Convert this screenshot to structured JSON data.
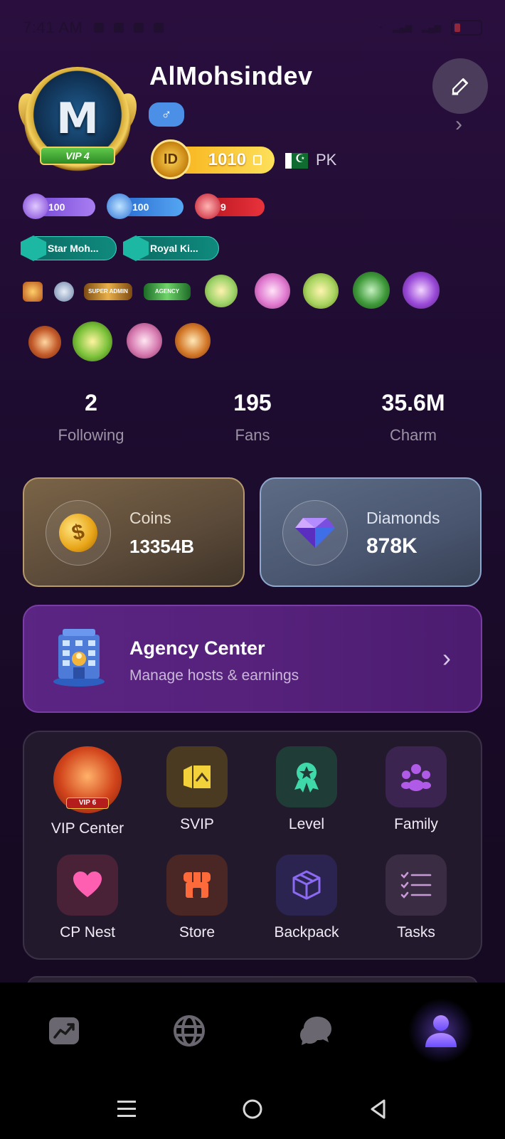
{
  "status_bar": {
    "time": "7:41 AM"
  },
  "profile": {
    "avatar_vip_label": "VIP 4",
    "avatar_letter": "M",
    "username": "AlMohsindev",
    "gender_symbol": "♂",
    "id_badge_label": "ID",
    "id_value": "1010",
    "country_code": "PK"
  },
  "level_badges": [
    {
      "value": "100",
      "color": "purple"
    },
    {
      "value": "100",
      "color": "blue"
    },
    {
      "value": "9",
      "color": "red"
    }
  ],
  "title_badges": [
    "Star Moh...",
    "Royal Ki..."
  ],
  "medal_labels": [
    "SUPER ADMIN",
    "AGENCY"
  ],
  "stats": {
    "following": {
      "value": "2",
      "label": "Following"
    },
    "fans": {
      "value": "195",
      "label": "Fans"
    },
    "charm": {
      "value": "35.6M",
      "label": "Charm"
    }
  },
  "wallet": {
    "coins": {
      "label": "Coins",
      "value": "13354B"
    },
    "diamonds": {
      "label": "Diamonds",
      "value": "878K"
    }
  },
  "agency": {
    "title": "Agency Center",
    "subtitle": "Manage hosts & earnings"
  },
  "menu": {
    "vip_badge_label": "VIP 6",
    "items": [
      {
        "label": "VIP Center",
        "icon": "vip-crest-icon"
      },
      {
        "label": "SVIP",
        "icon": "svip-icon"
      },
      {
        "label": "Level",
        "icon": "level-award-icon"
      },
      {
        "label": "Family",
        "icon": "family-icon"
      },
      {
        "label": "CP Nest",
        "icon": "heart-icon"
      },
      {
        "label": "Store",
        "icon": "store-icon"
      },
      {
        "label": "Backpack",
        "icon": "box-icon"
      },
      {
        "label": "Tasks",
        "icon": "tasks-list-icon"
      }
    ]
  },
  "bottom_nav": [
    "trending-icon",
    "globe-icon",
    "chat-icon",
    "profile-icon"
  ],
  "colors": {
    "accent": "#8a5cff",
    "agency_bg": "#55217a",
    "id_gold": "#f8b21b"
  }
}
